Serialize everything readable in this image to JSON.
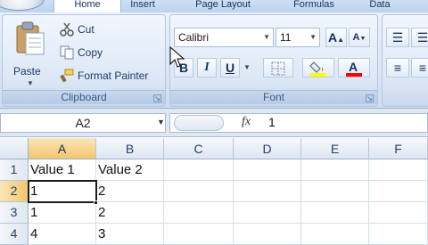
{
  "tabs": [
    {
      "label": "Home",
      "active": true
    },
    {
      "label": "Insert",
      "active": false
    },
    {
      "label": "Page Layout",
      "active": false
    },
    {
      "label": "Formulas",
      "active": false
    },
    {
      "label": "Data",
      "active": false
    }
  ],
  "clipboard": {
    "paste_label": "Paste",
    "cut_label": "Cut",
    "copy_label": "Copy",
    "format_painter_label": "Format Painter",
    "group_label": "Clipboard"
  },
  "font": {
    "name": "Calibri",
    "size": "11",
    "grow_label": "A",
    "shrink_label": "A",
    "bold_label": "B",
    "italic_label": "I",
    "underline_label": "U",
    "group_label": "Font",
    "fill_color": "#ffff00",
    "font_color": "#ff0000"
  },
  "formula_bar": {
    "name_box": "A2",
    "fx_label": "fx",
    "content": "1"
  },
  "grid": {
    "columns": [
      "A",
      "B",
      "C",
      "D",
      "E",
      "F"
    ],
    "rows": [
      {
        "num": "1",
        "cells": [
          "Value 1",
          "Value 2",
          "",
          "",
          "",
          ""
        ]
      },
      {
        "num": "2",
        "cells": [
          "1",
          "2",
          "",
          "",
          "",
          ""
        ]
      },
      {
        "num": "3",
        "cells": [
          "1",
          "2",
          "",
          "",
          "",
          ""
        ]
      },
      {
        "num": "4",
        "cells": [
          "4",
          "3",
          "",
          "",
          "",
          ""
        ]
      }
    ],
    "active_cell": "A2",
    "selected_column": "A",
    "selected_row": "2"
  },
  "colors": {
    "ribbon_bg": "#dbe6f4",
    "selection_header": "#f2c56f",
    "text_blue": "#1e3a66"
  }
}
